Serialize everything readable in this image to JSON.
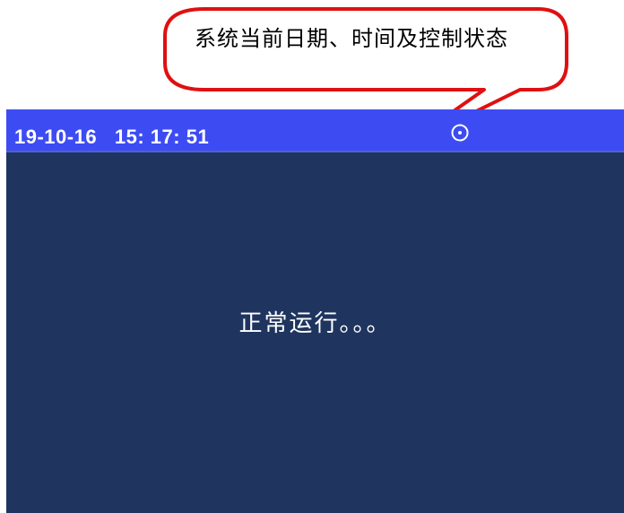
{
  "callout": {
    "text": "系统当前日期、时间及控制状态"
  },
  "status_bar": {
    "datetime": "19-10-16   15: 17: 51",
    "control_icon": "circle-dot-icon"
  },
  "main": {
    "status_message": "正常运行。。。"
  },
  "colors": {
    "status_bar_bg": "#3d4cf2",
    "screen_bg": "#1f355f",
    "callout_border": "#e01010"
  }
}
